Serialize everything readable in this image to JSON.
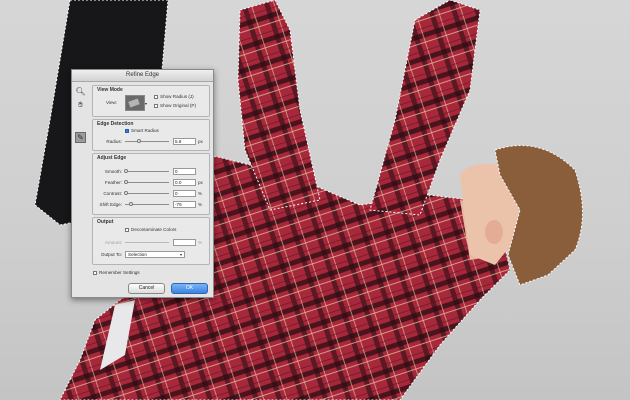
{
  "dialog": {
    "title": "Refine Edge",
    "view_mode": {
      "title": "View Mode",
      "view_label": "View:",
      "show_radius": "Show Radius (J)",
      "show_original": "Show Original (P)"
    },
    "edge_detection": {
      "title": "Edge Detection",
      "smart_radius": "Smart Radius",
      "radius_label": "Radius:",
      "radius_value": "5.8",
      "radius_unit": "px"
    },
    "adjust_edge": {
      "title": "Adjust Edge",
      "smooth_label": "Smooth:",
      "smooth_value": "0",
      "feather_label": "Feather:",
      "feather_value": "0.0",
      "feather_unit": "px",
      "contrast_label": "Contrast:",
      "contrast_value": "0",
      "contrast_unit": "%",
      "shift_label": "Shift Edge:",
      "shift_value": "-76",
      "shift_unit": "%"
    },
    "output": {
      "title": "Output",
      "decontaminate": "Decontaminate Colors",
      "amount_label": "Amount:",
      "amount_unit": "%",
      "output_to_label": "Output To:",
      "output_to_value": "Selection"
    },
    "remember": "Remember Settings",
    "cancel": "Cancel",
    "ok": "OK"
  },
  "icons": {
    "zoom": "magnifier-icon",
    "hand": "hand-icon",
    "brush": "refine-brush-icon"
  },
  "colors": {
    "shirt": "#a8283b",
    "ok_button": "#3a83e0",
    "background": "#cfcfcf"
  }
}
